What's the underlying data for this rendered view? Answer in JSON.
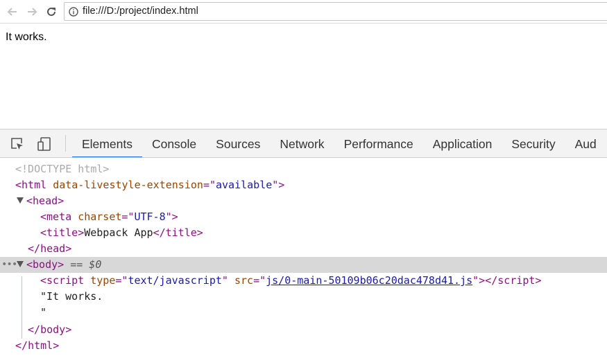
{
  "browser": {
    "url": "file:///D:/project/index.html",
    "icons": [
      "back-arrow-icon",
      "forward-arrow-icon",
      "reload-icon",
      "info-icon"
    ]
  },
  "page": {
    "text": "It works."
  },
  "devtools": {
    "tabs": [
      "Elements",
      "Console",
      "Sources",
      "Network",
      "Performance",
      "Application",
      "Security",
      "Aud"
    ],
    "active_tab": "Elements",
    "accent_color": "#1a73e8",
    "dom": {
      "doctype": "<!DOCTYPE html>",
      "html_open_tag": "html",
      "html_attr_name": "data-livestyle-extension",
      "html_attr_value": "available",
      "head_tag": "head",
      "meta_tag": "meta",
      "meta_attr_name": "charset",
      "meta_attr_value": "UTF-8",
      "title_tag": "title",
      "title_text": "Webpack App",
      "body_tag": "body",
      "selected_marker": "== $0",
      "script_tag": "script",
      "script_type_name": "type",
      "script_type_value": "text/javascript",
      "script_src_name": "src",
      "script_src_value": "js/0-main-50109b06c20dac478d41.js",
      "text_node_line1": "\"It works.",
      "text_node_line2": "\""
    }
  }
}
